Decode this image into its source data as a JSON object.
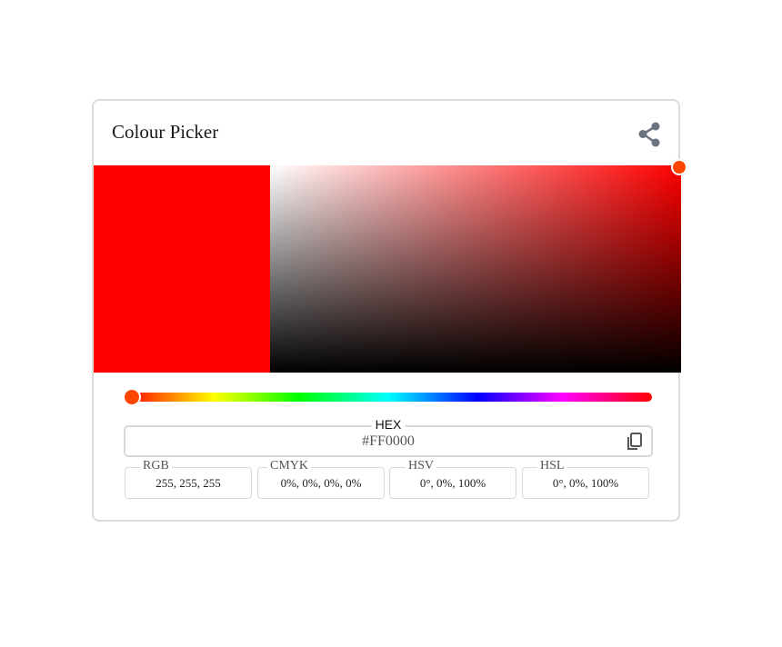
{
  "app": {
    "title": "Colour Picker",
    "share_icon": "share-icon",
    "copy_icon": "copy-icon"
  },
  "colors": {
    "current": "#FF0000",
    "thumb": "#FF4500",
    "border": "#D8D8D8"
  },
  "hue": {
    "value_degrees": 0
  },
  "saturation_value": {
    "saturation_percent": 100,
    "value_percent": 100
  },
  "fields": {
    "hex": {
      "label": "HEX",
      "value": "#FF0000"
    },
    "rgb": {
      "label": "RGB",
      "value": "255, 255, 255"
    },
    "cmyk": {
      "label": "CMYK",
      "value": "0%, 0%, 0%, 0%"
    },
    "hsv": {
      "label": "HSV",
      "value": "0°, 0%, 100%"
    },
    "hsl": {
      "label": "HSL",
      "value": "0°, 0%, 100%"
    }
  }
}
